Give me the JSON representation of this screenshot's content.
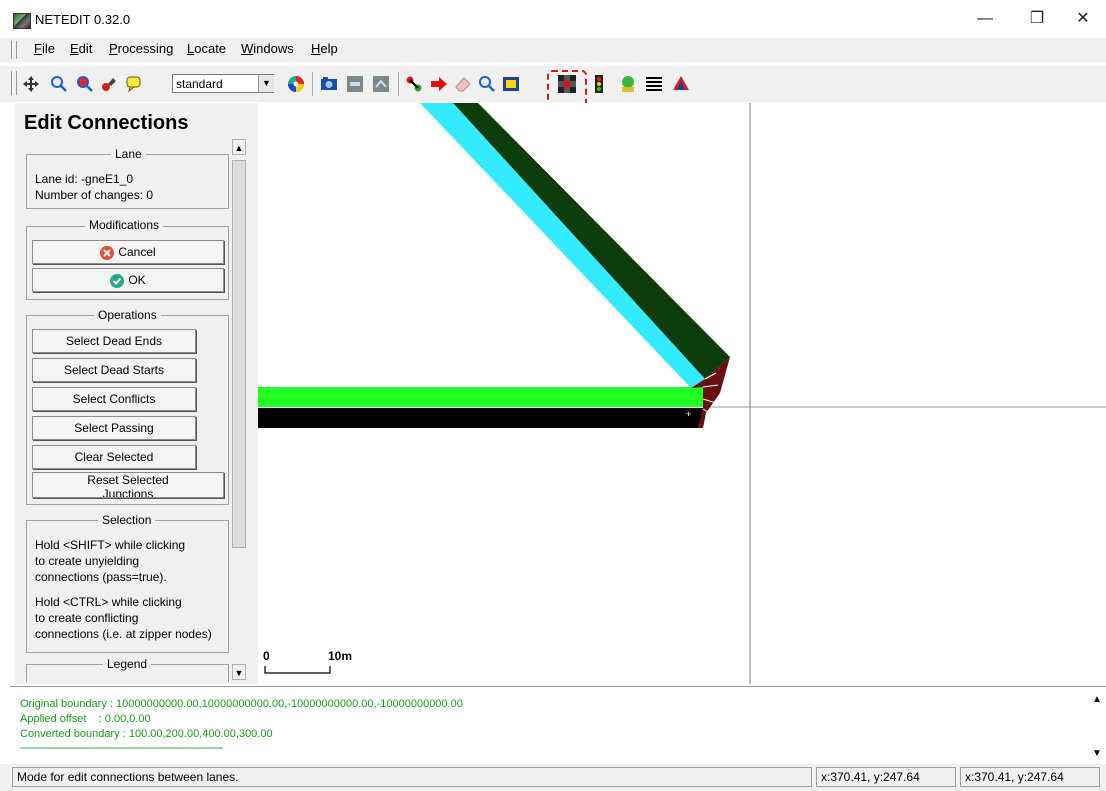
{
  "window": {
    "title": "NETEDIT 0.32.0",
    "minimize_label": "—",
    "restore_label": "❐",
    "close_label": "✕"
  },
  "menu": {
    "items": [
      {
        "label": "File",
        "hotkey": "F",
        "rest": "ile"
      },
      {
        "label": "Edit",
        "hotkey": "E",
        "rest": "dit"
      },
      {
        "label": "Processing",
        "hotkey": "P",
        "rest": "rocessing"
      },
      {
        "label": "Locate",
        "hotkey": "L",
        "rest": "ocate"
      },
      {
        "label": "Windows",
        "hotkey": "W",
        "rest": "indows"
      },
      {
        "label": "Help",
        "hotkey": "H",
        "rest": "elp"
      }
    ]
  },
  "toolbar": {
    "scheme_value": "standard",
    "icons": [
      "recenter-view-icon",
      "locate-junction-icon",
      "locate-edge-icon",
      "locate-vehicle-icon",
      "locate-poi-icon",
      "color-wheel-icon",
      "screenshot-icon",
      "route-icon",
      "image-icon",
      "connect-mode-icon",
      "move-mode-icon",
      "delete-mode-icon",
      "inspect-mode-icon",
      "select-mode-icon",
      "edit-connections-icon",
      "traffic-light-icon",
      "additionals-icon",
      "crossings-icon",
      "polygons-icon"
    ]
  },
  "panel": {
    "title": "Edit Connections",
    "lane_group_label": "Lane",
    "lane_id_text": "Lane id: -gneE1_0",
    "changes_text": "Number of changes: 0",
    "modifications_label": "Modifications",
    "cancel_label": "Cancel",
    "ok_label": "OK",
    "operations_label": "Operations",
    "operations": [
      "Select Dead Ends",
      "Select Dead Starts",
      "Select Conflicts",
      "Select Passing",
      "Clear Selected"
    ],
    "reset_label_line1": "Reset Selected",
    "reset_label_line2": "Junctions",
    "selection_label": "Selection",
    "selection_text1_l1": "Hold <SHIFT> while clicking",
    "selection_text1_l2": "to create unyielding",
    "selection_text1_l3": "connections (pass=true).",
    "selection_text2_l1": "Hold <CTRL> while clicking",
    "selection_text2_l2": "to create conflicting",
    "selection_text2_l3": "connections (i.e. at zipper nodes)",
    "legend_label": "Legend"
  },
  "canvas": {
    "scale_zero": "0",
    "scale_label": "10m"
  },
  "messages": {
    "line1": "Original boundary : 10000000000.00,10000000000.00,-10000000000.00,-10000000000.00",
    "line2": "Applied offset    : 0.00,0.00",
    "line3": "Converted boundary : 100.00,200.00,400.00,300.00",
    "line4": "----------------------------------------------------------------------------"
  },
  "status": {
    "mode_text": "Mode for edit connections between lanes.",
    "coord1": "x:370.41, y:247.64",
    "coord2": "x:370.41, y:247.64"
  },
  "colors": {
    "lane_cyan": "#33eaff",
    "lane_dark_green": "#0d3d0d",
    "lane_green": "#22ff22",
    "lane_black": "#000000",
    "junction": "#6b1010",
    "message_green": "#1a9a1a",
    "highlight_red": "#d01818"
  }
}
